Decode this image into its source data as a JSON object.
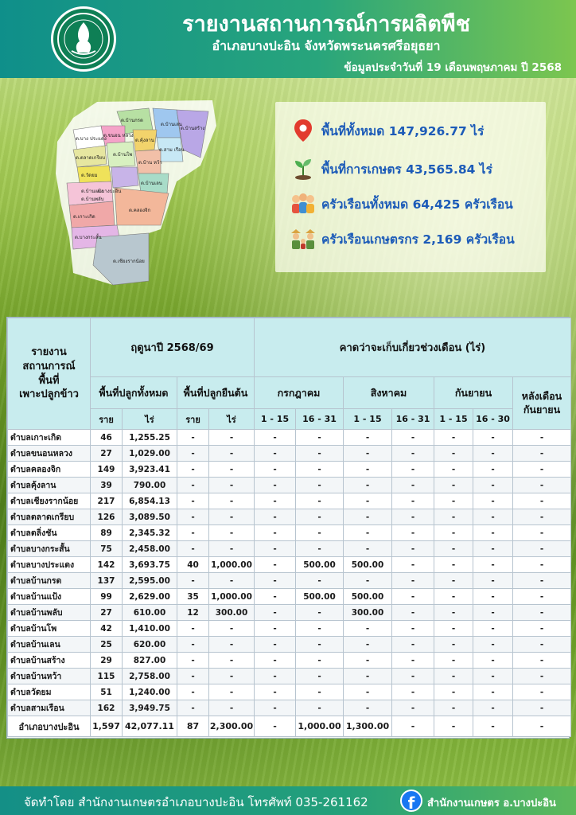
{
  "header": {
    "title": "รายงานสถานการณ์การผลิตพืช",
    "subtitle": "อำเภอบางปะอิน จังหวัดพระนครศรีอยุธยา",
    "date_text": "ข้อมูลประจำวันที่  19  เดือนพฤษภาคม ปี 2568"
  },
  "map": {
    "labels": [
      "ต.บ้านกรด",
      "ต.บ้านเลน",
      "ต.บ้านสร้าง",
      "ต.บาง ประแดง",
      "ต.ขนอน หลวง",
      "ต.คุ้งลาน",
      "ต.สาม เรือน",
      "ต.ตลาดเกรียบ",
      "ต.บ้านโพ",
      "ต.วัดยม",
      "ต.บ้าน หว้า",
      "ต.บ้านแป้ง",
      "ต.บ้านพลับ",
      "ต.บ้านเลน",
      "ต.เกาะเกิด",
      "ต.คลองจิก",
      "อ.บางปะอิน",
      "ต.บางกระสั้น",
      "ต.เชียงรากน้อย"
    ]
  },
  "stats": {
    "total_area": "พื้นที่ทั้งหมด 147,926.77 ไร่",
    "farm_area": "พื้นที่การเกษตร 43,565.84 ไร่",
    "households": "ครัวเรือนทั้งหมด 64,425 ครัวเรือน",
    "farm_households": "ครัวเรือนเกษตรกร 2,169 ครัวเรือน"
  },
  "table": {
    "corner": "รายงาน\nสถานการณ์\nพื้นที่\nเพาะปลูกข้าว",
    "season": "ฤดูนาปี 2568/69",
    "harvest": "คาดว่าจะเก็บเกี่ยวช่วงเดือน (ไร่)",
    "planted_total": "พื้นที่ปลูกทั้งหมด",
    "planted_standing": "พื้นที่ปลูกยืนต้น",
    "months": [
      "กรกฎาคม",
      "สิงหาคม",
      "กันยายน",
      "หลังเดือน\nกันยายน"
    ],
    "sub": [
      "ราย",
      "ไร่",
      "ราย",
      "ไร่",
      "1 - 15",
      "16 - 31",
      "1 - 15",
      "16 - 31",
      "1 - 15",
      "16 - 30"
    ],
    "rows": [
      [
        "ตำบลเกาะเกิด",
        "46",
        "1,255.25",
        "-",
        "-",
        "-",
        "-",
        "-",
        "-",
        "-",
        "-",
        "-"
      ],
      [
        "ตำบลขนอนหลวง",
        "27",
        "1,029.00",
        "-",
        "-",
        "-",
        "-",
        "-",
        "-",
        "-",
        "-",
        "-"
      ],
      [
        "ตำบลคลองจิก",
        "149",
        "3,923.41",
        "-",
        "-",
        "-",
        "-",
        "-",
        "-",
        "-",
        "-",
        "-"
      ],
      [
        "ตำบลคุ้งลาน",
        "39",
        "790.00",
        "-",
        "-",
        "-",
        "-",
        "-",
        "-",
        "-",
        "-",
        "-"
      ],
      [
        "ตำบลเชียงรากน้อย",
        "217",
        "6,854.13",
        "-",
        "-",
        "-",
        "-",
        "-",
        "-",
        "-",
        "-",
        "-"
      ],
      [
        "ตำบลตลาดเกรียบ",
        "126",
        "3,089.50",
        "-",
        "-",
        "-",
        "-",
        "-",
        "-",
        "-",
        "-",
        "-"
      ],
      [
        "ตำบลตลิ่งชัน",
        "89",
        "2,345.32",
        "-",
        "-",
        "-",
        "-",
        "-",
        "-",
        "-",
        "-",
        "-"
      ],
      [
        "ตำบลบางกระสั้น",
        "75",
        "2,458.00",
        "-",
        "-",
        "-",
        "-",
        "-",
        "-",
        "-",
        "-",
        "-"
      ],
      [
        "ตำบลบางประแดง",
        "142",
        "3,693.75",
        "40",
        "1,000.00",
        "-",
        "500.00",
        "500.00",
        "-",
        "-",
        "-",
        "-"
      ],
      [
        "ตำบลบ้านกรด",
        "137",
        "2,595.00",
        "-",
        "-",
        "-",
        "-",
        "-",
        "-",
        "-",
        "-",
        "-"
      ],
      [
        "ตำบลบ้านแป้ง",
        "99",
        "2,629.00",
        "35",
        "1,000.00",
        "-",
        "500.00",
        "500.00",
        "-",
        "-",
        "-",
        "-"
      ],
      [
        "ตำบลบ้านพลับ",
        "27",
        "610.00",
        "12",
        "300.00",
        "-",
        "-",
        "300.00",
        "-",
        "-",
        "-",
        "-"
      ],
      [
        "ตำบลบ้านโพ",
        "42",
        "1,410.00",
        "-",
        "-",
        "-",
        "-",
        "-",
        "-",
        "-",
        "-",
        "-"
      ],
      [
        "ตำบลบ้านเลน",
        "25",
        "620.00",
        "-",
        "-",
        "-",
        "-",
        "-",
        "-",
        "-",
        "-",
        "-"
      ],
      [
        "ตำบลบ้านสร้าง",
        "29",
        "827.00",
        "-",
        "-",
        "-",
        "-",
        "-",
        "-",
        "-",
        "-",
        "-"
      ],
      [
        "ตำบลบ้านหว้า",
        "115",
        "2,758.00",
        "-",
        "-",
        "-",
        "-",
        "-",
        "-",
        "-",
        "-",
        "-"
      ],
      [
        "ตำบลวัดยม",
        "51",
        "1,240.00",
        "-",
        "-",
        "-",
        "-",
        "-",
        "-",
        "-",
        "-",
        "-"
      ],
      [
        "ตำบลสามเรือน",
        "162",
        "3,949.75",
        "-",
        "-",
        "-",
        "-",
        "-",
        "-",
        "-",
        "-",
        "-"
      ]
    ],
    "total": [
      "อำเภอบางปะอิน",
      "1,597",
      "42,077.11",
      "87",
      "2,300.00",
      "-",
      "1,000.00",
      "1,300.00",
      "-",
      "-",
      "-",
      "-"
    ]
  },
  "footer": {
    "made_by": "จัดทำโดย สำนักงานเกษตรอำเภอบางปะอิน  โทรศัพท์  035-261162",
    "fb_page": "สำนักงานเกษตร อ.บางปะอิน"
  }
}
